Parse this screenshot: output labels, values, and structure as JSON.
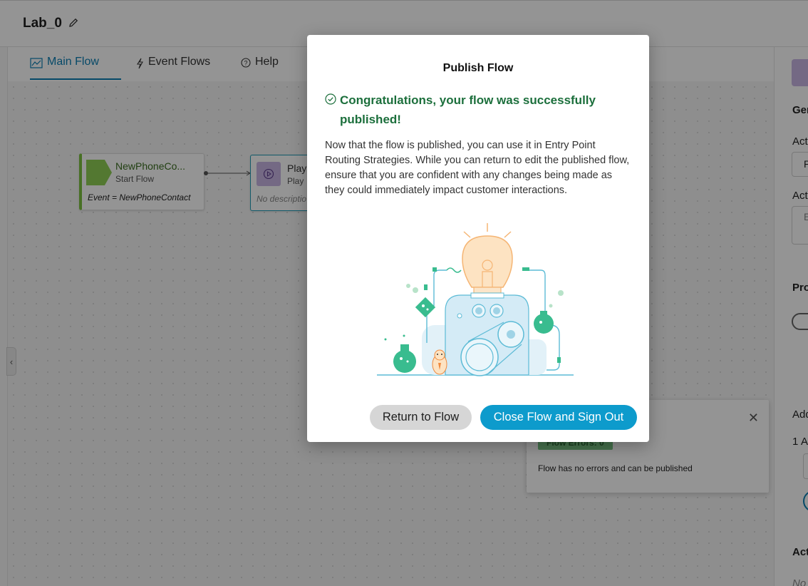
{
  "header": {
    "title": "Lab_0"
  },
  "tabs": [
    {
      "label": "Main Flow"
    },
    {
      "label": "Event Flows"
    },
    {
      "label": "Help"
    }
  ],
  "canvas": {
    "start_node": {
      "title": "NewPhoneCo...",
      "subtitle": "Start Flow",
      "event": "Event = NewPhoneContact"
    },
    "play_node": {
      "title": "Play",
      "subtitle": "Play",
      "description": "No descriptio"
    },
    "validation": {
      "badge": "Flow Errors: 0",
      "message": "Flow has no errors and can be published"
    }
  },
  "right_panel": {
    "general": "Ger",
    "activity_label_1": "Act",
    "activity_value_1": "P",
    "activity_label_2": "Act",
    "activity_value_2": "E",
    "properties": "Pro",
    "add": "Add",
    "row_number": "1",
    "row_letter": "A",
    "actions": "Act",
    "no_value": "No"
  },
  "modal": {
    "title": "Publish Flow",
    "success": "Congratulations, your flow was successfully published!",
    "body": "Now that the flow is published, you can use it in Entry Point Routing Strategies. While you can return to edit the published flow, ensure that you are confident with any changes being made as they could immediately impact customer interactions.",
    "return_button": "Return to Flow",
    "close_button": "Close Flow and Sign Out"
  },
  "colors": {
    "accent": "#0d9bcc",
    "success": "#1c6f3c",
    "tab_active": "#0c7fb3"
  },
  "icons": [
    "pencil-icon",
    "flow-chart-icon",
    "lightning-icon",
    "help-circle-icon",
    "play-icon",
    "check-circle-icon",
    "close-icon",
    "chevron-left-icon"
  ]
}
